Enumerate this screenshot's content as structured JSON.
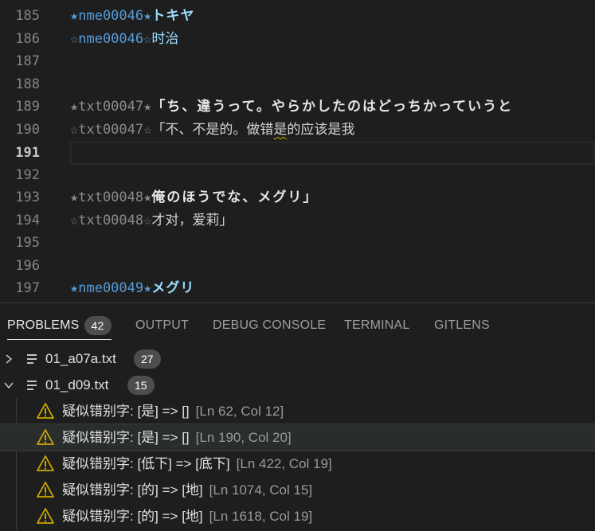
{
  "editor": {
    "lines": [
      {
        "num": "185",
        "marker": "★nme00046★",
        "text": "トキヤ",
        "kind": "ja-name"
      },
      {
        "num": "186",
        "marker": "☆nme00046☆",
        "text": "时治",
        "kind": "zh-name"
      },
      {
        "num": "187",
        "marker": "",
        "text": "",
        "kind": "blank"
      },
      {
        "num": "188",
        "marker": "",
        "text": "",
        "kind": "blank"
      },
      {
        "num": "189",
        "marker": "★txt00047★",
        "text": "「ち、違うって。やらかしたのはどっちかっていうと",
        "kind": "ja"
      },
      {
        "num": "190",
        "marker": "☆txt00047☆",
        "text_before": "「不、不是的。做错",
        "text_squiggle": "是",
        "text_after": "的应该是我",
        "kind": "zh-squiggle"
      },
      {
        "num": "191",
        "marker": "",
        "text": "",
        "kind": "current"
      },
      {
        "num": "192",
        "marker": "",
        "text": "",
        "kind": "blank"
      },
      {
        "num": "193",
        "marker": "★txt00048★",
        "text": "俺のほうでな、メグリ」",
        "kind": "ja"
      },
      {
        "num": "194",
        "marker": "☆txt00048☆",
        "text": "才对，爱莉」",
        "kind": "zh"
      },
      {
        "num": "195",
        "marker": "",
        "text": "",
        "kind": "blank"
      },
      {
        "num": "196",
        "marker": "",
        "text": "",
        "kind": "blank"
      },
      {
        "num": "197",
        "marker": "★nme00049★",
        "text": "メグリ",
        "kind": "ja-name"
      }
    ]
  },
  "panel": {
    "tabs": {
      "problems": "PROBLEMS",
      "problems_count": "42",
      "output": "OUTPUT",
      "debug_console": "DEBUG CONSOLE",
      "terminal": "TERMINAL",
      "gitlens": "GITLENS"
    },
    "files": [
      {
        "name": "01_a07a.txt",
        "count": "27",
        "expanded": false
      },
      {
        "name": "01_d09.txt",
        "count": "15",
        "expanded": true
      }
    ],
    "problems": [
      {
        "message": "疑似错别字: [是] => []",
        "location": "[Ln 62, Col 12]"
      },
      {
        "message": "疑似错别字: [是] => []",
        "location": "[Ln 190, Col 20]"
      },
      {
        "message": "疑似错别字: [低下] => [底下]",
        "location": "[Ln 422, Col 19]"
      },
      {
        "message": "疑似错别字: [的] => [地]",
        "location": "[Ln 1074, Col 15]"
      },
      {
        "message": "疑似错别字: [的] => [地]",
        "location": "[Ln 1618, Col 19]"
      }
    ]
  },
  "colors": {
    "background": "#1e1e1e",
    "marker": "#569cd6",
    "warning": "#cca700",
    "badge": "#4d4d4d"
  },
  "icons": {
    "collapsed": "chevron-right-icon",
    "expanded": "chevron-down-icon",
    "file": "file-lines-icon",
    "warning": "warning-triangle-icon"
  }
}
